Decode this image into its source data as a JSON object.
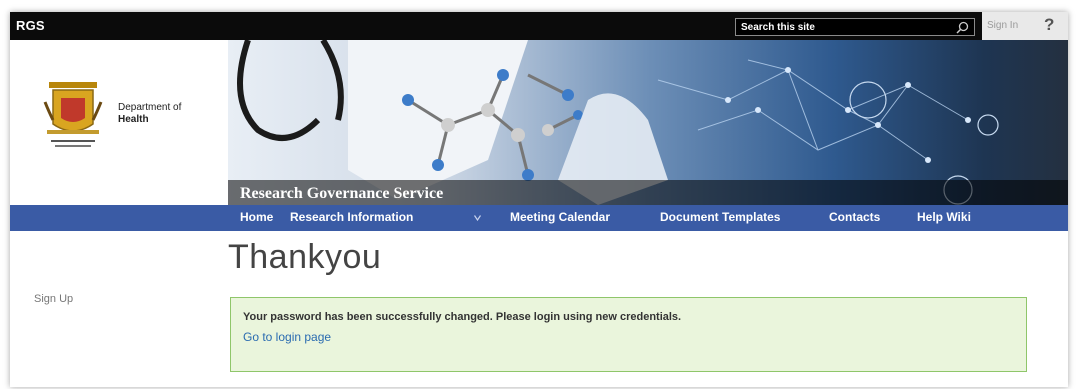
{
  "suite_bar": {
    "site_code": "RGS",
    "search_placeholder": "Search this site",
    "sign_in": "Sign In",
    "help": "?"
  },
  "header": {
    "dept_line1": "Department of",
    "dept_line2": "Health",
    "banner_title": "Research Governance Service"
  },
  "nav": {
    "items": [
      "Home",
      "Research Information",
      "Meeting Calendar",
      "Document Templates",
      "Contacts",
      "Help Wiki"
    ]
  },
  "left_nav": {
    "sign_up": "Sign Up"
  },
  "main": {
    "title": "Thankyou",
    "message": "Your password has been successfully changed. Please login using new credentials.",
    "login_link": "Go to login page"
  },
  "colors": {
    "nav_bar": "#3a5ba5",
    "message_bg": "#eaf5dc",
    "message_border": "#8fc66a",
    "link": "#2a6bb0"
  }
}
